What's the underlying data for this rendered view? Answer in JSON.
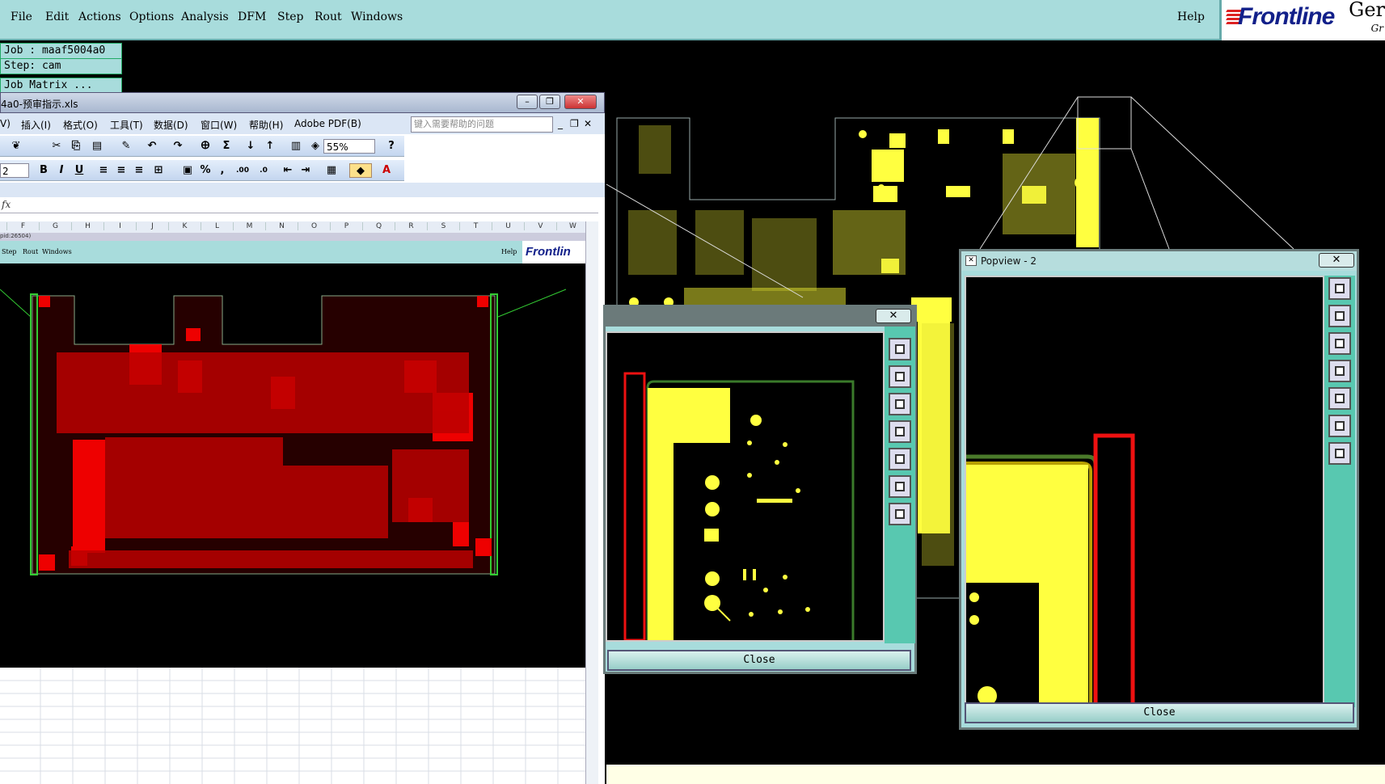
{
  "app_menu": [
    "File",
    "Edit",
    "Actions",
    "Options",
    "Analysis",
    "DFM",
    "Step",
    "Rout",
    "Windows"
  ],
  "help_label": "Help",
  "logo": {
    "text": "Frontline",
    "product": "Ger",
    "product2": "Gr"
  },
  "job": {
    "job_label": "Job : maaf5004a0",
    "step_label": "Step: cam",
    "matrix_label": "Job Matrix ..."
  },
  "excel": {
    "title": "4a0-预审指示.xls",
    "menu": [
      "V)",
      "插入(I)",
      "格式(O)",
      "工具(T)",
      "数据(D)",
      "窗口(W)",
      "帮助(H)",
      "Adobe PDF(B)"
    ],
    "help_placeholder": "键入需要帮助的问题",
    "zoom": "55%",
    "font_size": "2",
    "fx": "fx",
    "columns": [
      "F",
      "G",
      "H",
      "I",
      "J",
      "K",
      "L",
      "M",
      "N",
      "O",
      "P",
      "Q",
      "R",
      "S",
      "T",
      "U",
      "V",
      "W"
    ],
    "embedded_pid": "pid:26504)",
    "embedded_menu": [
      "Step",
      "Rout",
      "Windows"
    ],
    "embedded_help": "Help",
    "embedded_logo": "Frontlin"
  },
  "popview1": {
    "close_label": "Close",
    "x_label": "✕"
  },
  "popview2": {
    "title": "Popview - 2",
    "close_label": "Close",
    "x_label": "✕"
  },
  "icons": [
    "app-icon",
    "zoom-home-icon",
    "zoom-up-icon",
    "zoom-down-icon",
    "zoom-left-icon",
    "zoom-right-icon",
    "zoom-fit-icon",
    "zoom-center-icon"
  ]
}
